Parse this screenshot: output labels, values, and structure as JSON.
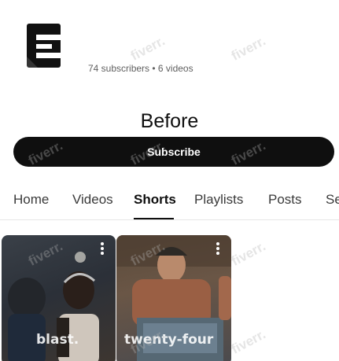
{
  "channel": {
    "stats": "74 subscribers • 6 videos",
    "title": "Before",
    "subscribe_label": "Subscribe"
  },
  "tabs": [
    {
      "label": "Home"
    },
    {
      "label": "Videos"
    },
    {
      "label": "Shorts",
      "active": true
    },
    {
      "label": "Playlists"
    },
    {
      "label": "Posts"
    },
    {
      "label": "Se"
    }
  ],
  "shorts": [
    {
      "caption": "blast."
    },
    {
      "caption": "twenty-four"
    }
  ],
  "watermark": "fiverr.",
  "colors": {
    "background": "#ffffff",
    "button": "#0f0f0f",
    "button_text": "#ffffff",
    "muted_text": "#606060"
  }
}
